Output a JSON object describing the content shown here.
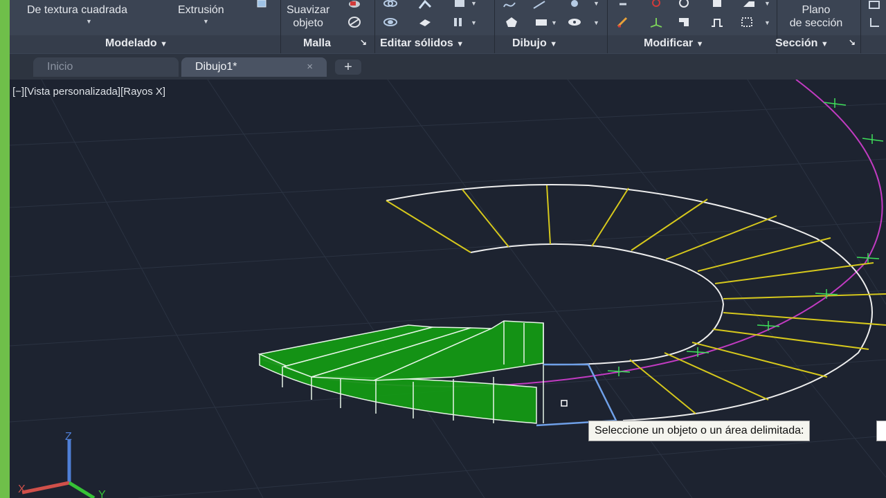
{
  "ribbon": {
    "buttons": {
      "textura_cuadrada": "De textura cuadrada",
      "extrusion": "Extrusión",
      "suavizar_line1": "Suavizar",
      "suavizar_line2": "objeto",
      "plano_line1": "Plano",
      "plano_line2": "de sección"
    },
    "panels": {
      "modelado": "Modelado",
      "malla": "Malla",
      "editar_solidos": "Editar sólidos",
      "dibujo": "Dibujo",
      "modificar": "Modificar",
      "seccion": "Sección"
    }
  },
  "tabs": [
    {
      "label": "Inicio"
    },
    {
      "label": "Dibujo1*",
      "close": "×"
    }
  ],
  "tab_add": "+",
  "viewport": {
    "label": "[−][Vista personalizada][Rayos X]",
    "tooltip": "Seleccione un objeto o un área delimitada:"
  },
  "ucs": {
    "z": "Z",
    "x": "X",
    "y": "Y"
  },
  "colors": {
    "viewport_bg": "#1d2330",
    "ribbon_bg": "#3b4453",
    "solid_fill": "#139c13",
    "yellow_lines": "#d6c81c",
    "path_magenta": "#c13bc1",
    "selection_blue": "#6fa0e8",
    "left_strip": "#6fbf4a"
  }
}
